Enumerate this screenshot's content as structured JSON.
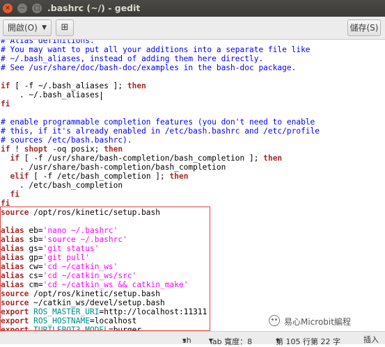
{
  "window": {
    "title": ".bashrc (~/) - gedit",
    "buttons": {
      "close_icon": "×",
      "minimize_icon": "−",
      "maximize_icon": "□"
    }
  },
  "toolbar": {
    "open_label": "開啟(O)",
    "open_chevron": "▼",
    "new_doc_icon": "new-document-icon",
    "new_doc_glyph": "⊞",
    "save_label": "儲存(S)"
  },
  "editor": {
    "lines": [
      [
        {
          "t": "# Alias definitions.",
          "c": "comment"
        }
      ],
      [
        {
          "t": "# You may want to put all your additions into a separate file like",
          "c": "comment"
        }
      ],
      [
        {
          "t": "# ~/.bash_aliases, instead of adding them here directly.",
          "c": "comment"
        }
      ],
      [
        {
          "t": "# See /usr/share/doc/bash-doc/examples in the bash-doc package.",
          "c": "comment"
        }
      ],
      [],
      [
        {
          "t": "if",
          "c": "kw"
        },
        {
          "t": " [ -f ~/.bash_aliases ]; ",
          "c": "plain"
        },
        {
          "t": "then",
          "c": "kw"
        }
      ],
      [
        {
          "t": "    . ~/.bash_aliases",
          "c": "plain"
        }
      ],
      [
        {
          "t": "fi",
          "c": "kw"
        }
      ],
      [],
      [
        {
          "t": "# enable programmable completion features (you don't need to enable",
          "c": "comment"
        }
      ],
      [
        {
          "t": "# this, if it's already enabled in /etc/bash.bashrc and /etc/profile",
          "c": "comment"
        }
      ],
      [
        {
          "t": "# sources /etc/bash.bashrc).",
          "c": "comment"
        }
      ],
      [
        {
          "t": "if",
          "c": "kw"
        },
        {
          "t": " ! ",
          "c": "plain"
        },
        {
          "t": "shopt",
          "c": "kw"
        },
        {
          "t": " -oq posix; ",
          "c": "plain"
        },
        {
          "t": "then",
          "c": "kw"
        }
      ],
      [
        {
          "t": "  ",
          "c": "plain"
        },
        {
          "t": "if",
          "c": "kw"
        },
        {
          "t": " [ -f /usr/share/bash-completion/bash_completion ]; ",
          "c": "plain"
        },
        {
          "t": "then",
          "c": "kw"
        }
      ],
      [
        {
          "t": "    . /usr/share/bash-completion/bash_completion",
          "c": "plain"
        }
      ],
      [
        {
          "t": "  ",
          "c": "plain"
        },
        {
          "t": "elif",
          "c": "kw"
        },
        {
          "t": " [ -f /etc/bash_completion ]; ",
          "c": "plain"
        },
        {
          "t": "then",
          "c": "kw"
        }
      ],
      [
        {
          "t": "    . /etc/bash_completion",
          "c": "plain"
        }
      ],
      [
        {
          "t": "  ",
          "c": "plain"
        },
        {
          "t": "fi",
          "c": "kw"
        }
      ],
      [
        {
          "t": "fi",
          "c": "kw"
        }
      ],
      [
        {
          "t": "source",
          "c": "kw"
        },
        {
          "t": " /opt/ros/kinetic/setup.bash",
          "c": "plain"
        }
      ],
      [],
      [
        {
          "t": "alias",
          "c": "kw"
        },
        {
          "t": " eb=",
          "c": "plain"
        },
        {
          "t": "'nano ~/.bashrc'",
          "c": "str"
        }
      ],
      [
        {
          "t": "alias",
          "c": "kw"
        },
        {
          "t": " sb=",
          "c": "plain"
        },
        {
          "t": "'source ~/.bashrc'",
          "c": "str"
        }
      ],
      [
        {
          "t": "alias",
          "c": "kw"
        },
        {
          "t": " gs=",
          "c": "plain"
        },
        {
          "t": "'git status'",
          "c": "str"
        }
      ],
      [
        {
          "t": "alias",
          "c": "kw"
        },
        {
          "t": " gp=",
          "c": "plain"
        },
        {
          "t": "'git pull'",
          "c": "str"
        }
      ],
      [
        {
          "t": "alias",
          "c": "kw"
        },
        {
          "t": " cw=",
          "c": "plain"
        },
        {
          "t": "'cd ~/catkin_ws'",
          "c": "str"
        }
      ],
      [
        {
          "t": "alias",
          "c": "kw"
        },
        {
          "t": " cs=",
          "c": "plain"
        },
        {
          "t": "'cd ~/catkin_ws/src'",
          "c": "str"
        }
      ],
      [
        {
          "t": "alias",
          "c": "kw"
        },
        {
          "t": " cm=",
          "c": "plain"
        },
        {
          "t": "'cd ~/catkin_ws && catkin_make'",
          "c": "str"
        }
      ],
      [
        {
          "t": "source",
          "c": "kw"
        },
        {
          "t": " /opt/ros/kinetic/setup.bash",
          "c": "plain"
        }
      ],
      [
        {
          "t": "source",
          "c": "kw"
        },
        {
          "t": " ~/catkin_ws/devel/setup.bash",
          "c": "plain"
        }
      ],
      [
        {
          "t": "export",
          "c": "kw"
        },
        {
          "t": " ",
          "c": "plain"
        },
        {
          "t": "ROS_MASTER_URI",
          "c": "var"
        },
        {
          "t": "=http://localhost:11311",
          "c": "plain"
        }
      ],
      [
        {
          "t": "export",
          "c": "kw"
        },
        {
          "t": " ",
          "c": "plain"
        },
        {
          "t": "ROS_HOSTNAME",
          "c": "var"
        },
        {
          "t": "=localhost",
          "c": "plain"
        }
      ],
      [
        {
          "t": "export",
          "c": "kw"
        },
        {
          "t": " ",
          "c": "plain"
        },
        {
          "t": "TURTLEBOT3_MODEL",
          "c": "var"
        },
        {
          "t": "=burger",
          "c": "plain"
        }
      ]
    ]
  },
  "statusbar": {
    "language": "sh",
    "language_chevron": "▾",
    "tab_width": "Tab 寬度：8",
    "tab_chevron": "▾",
    "position": "第 105 行第 22 字",
    "position_chevron": "▾",
    "mode": "插入"
  },
  "watermark": {
    "text": "易心Microbit編程"
  },
  "colors": {
    "comment": "#0000ff",
    "keyword": "#a52a2a",
    "string": "#ff00ff",
    "variable": "#008b8b",
    "highlight_box": "#e04040",
    "close_button": "#e9582d"
  }
}
